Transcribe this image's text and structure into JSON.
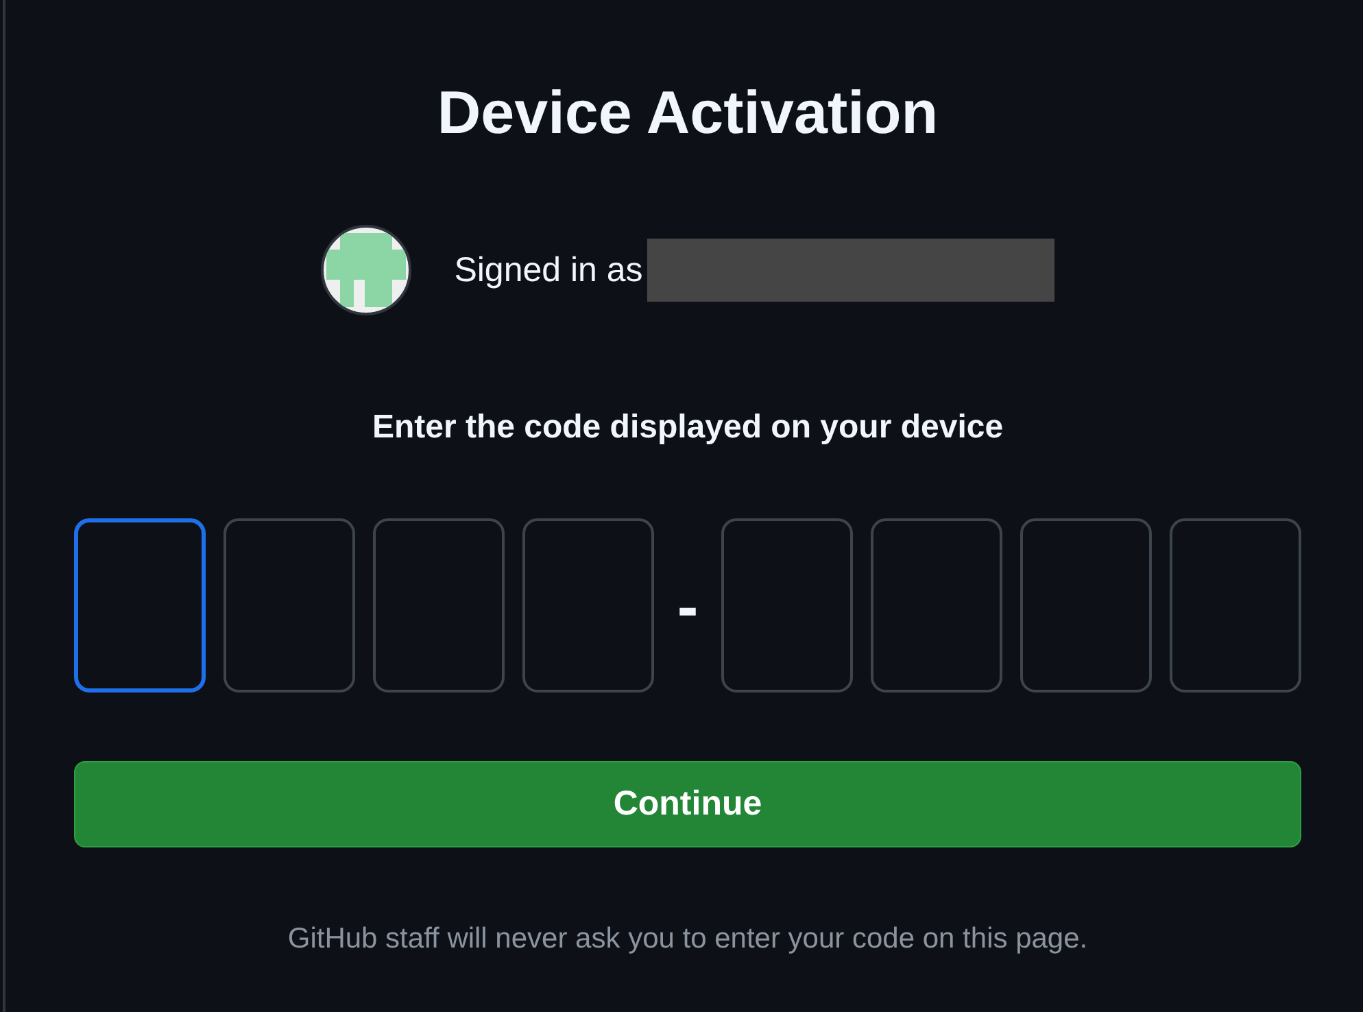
{
  "title": "Device Activation",
  "account": {
    "label": "Signed in as",
    "name_redacted": true
  },
  "instruction": "Enter the code displayed on your device",
  "code_boxes": [
    {
      "selected": true
    },
    {
      "selected": false
    },
    {
      "selected": false
    },
    {
      "selected": false
    },
    {
      "kind": "separator",
      "text": "-"
    },
    {
      "selected": false
    },
    {
      "selected": false
    },
    {
      "selected": false
    },
    {
      "selected": false
    }
  ],
  "button": "Continue",
  "footer": "GitHub staff will never ask you to enter your code on this page."
}
